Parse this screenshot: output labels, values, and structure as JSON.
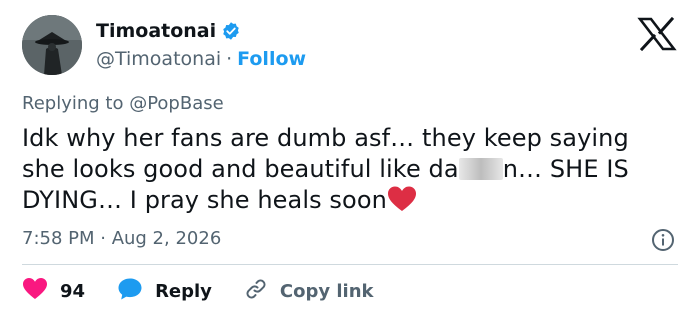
{
  "author": {
    "display_name": "Timoatonai",
    "handle": "@Timoatonai",
    "separator": "·",
    "follow_label": "Follow"
  },
  "replying": {
    "prefix": "Replying to ",
    "mention": "@PopBase"
  },
  "tweet": {
    "text_part1": "Idk why her fans are dumb asf… they keep saying she looks good and beautiful like da",
    "text_part2": "n… SHE IS DYING… I pray she heals soon"
  },
  "meta": {
    "timestamp": "7:58 PM · Aug 2, 2026"
  },
  "actions": {
    "like_count": "94",
    "reply_label": "Reply",
    "copy_label": "Copy link"
  },
  "colors": {
    "accent": "#1d9bf0",
    "like": "#f91880",
    "muted": "#536471",
    "text": "#0f1419",
    "divider": "#cfd9de"
  },
  "icons": [
    "verified-badge-icon",
    "x-logo-icon",
    "info-icon",
    "heart-icon",
    "reply-bubble-icon",
    "link-icon",
    "red-heart-emoji"
  ]
}
